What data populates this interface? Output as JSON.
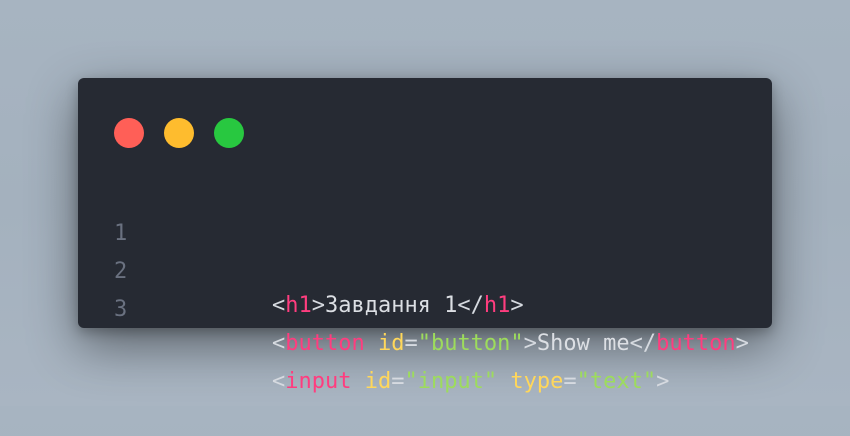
{
  "window_controls": {
    "close_color": "#ff5f57",
    "minimize_color": "#febc2e",
    "maximize_color": "#28c840"
  },
  "colors": {
    "tag": "#ff3d7f",
    "attribute": "#ffd75a",
    "string": "#9ddc5c",
    "punctuation": "#d6dae0",
    "text": "#dcdfe4",
    "line_number": "#6a7180",
    "editor_bg": "#262a33"
  },
  "code": {
    "lines": [
      {
        "number": "1",
        "tokens": [
          {
            "type": "punct",
            "text": "<"
          },
          {
            "type": "tag",
            "text": "h1"
          },
          {
            "type": "punct",
            "text": ">"
          },
          {
            "type": "text",
            "text": "Завдання 1"
          },
          {
            "type": "punct",
            "text": "</"
          },
          {
            "type": "tag",
            "text": "h1"
          },
          {
            "type": "punct",
            "text": ">"
          }
        ]
      },
      {
        "number": "2",
        "tokens": [
          {
            "type": "punct",
            "text": "<"
          },
          {
            "type": "tag",
            "text": "button"
          },
          {
            "type": "punct",
            "text": " "
          },
          {
            "type": "attr",
            "text": "id"
          },
          {
            "type": "punct",
            "text": "="
          },
          {
            "type": "str",
            "text": "\"button\""
          },
          {
            "type": "punct",
            "text": ">"
          },
          {
            "type": "text",
            "text": "Show me"
          },
          {
            "type": "punct",
            "text": "</"
          },
          {
            "type": "tag",
            "text": "button"
          },
          {
            "type": "punct",
            "text": ">"
          }
        ]
      },
      {
        "number": "3",
        "tokens": [
          {
            "type": "punct",
            "text": "<"
          },
          {
            "type": "tag",
            "text": "input"
          },
          {
            "type": "punct",
            "text": " "
          },
          {
            "type": "attr",
            "text": "id"
          },
          {
            "type": "punct",
            "text": "="
          },
          {
            "type": "str",
            "text": "\"input\""
          },
          {
            "type": "punct",
            "text": " "
          },
          {
            "type": "attr",
            "text": "type"
          },
          {
            "type": "punct",
            "text": "="
          },
          {
            "type": "str",
            "text": "\"text\""
          },
          {
            "type": "punct",
            "text": ">"
          }
        ]
      }
    ]
  }
}
